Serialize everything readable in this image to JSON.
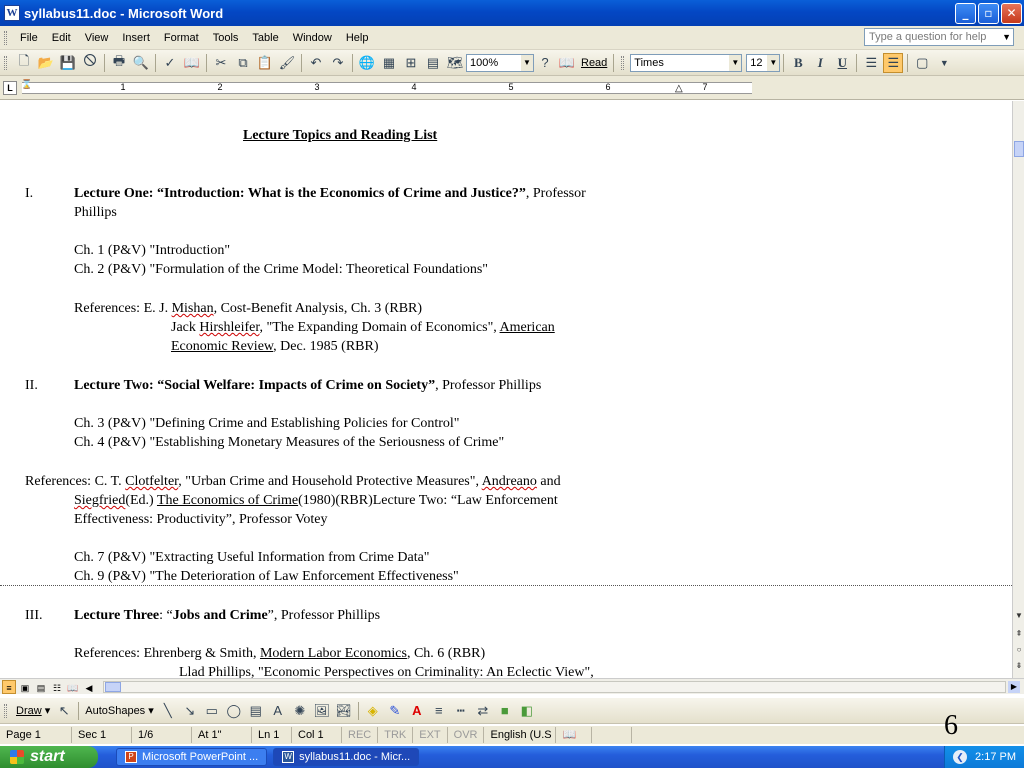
{
  "window": {
    "title": "syllabus11.doc - Microsoft Word",
    "min": "_",
    "max": "▫",
    "close": "✕"
  },
  "menu": {
    "items": [
      "File",
      "Edit",
      "View",
      "Insert",
      "Format",
      "Tools",
      "Table",
      "Window",
      "Help"
    ],
    "help_placeholder": "Type a question for help"
  },
  "toolbar": {
    "zoom": "100%",
    "read_label": "Read",
    "font": "Times",
    "font_size": "12",
    "bold": "B",
    "italic": "I",
    "underline": "U"
  },
  "ruler": {
    "numbers": [
      "1",
      "2",
      "3",
      "4",
      "5",
      "6",
      "7"
    ],
    "tab_selector": "L"
  },
  "document": {
    "heading": "Lecture Topics and Reading List",
    "l1_num": "I.",
    "l1_a": "Lecture One: “Introduction: What is the Economics of Crime and Justice?”",
    "l1_b": ", Professor",
    "l1_c": "Phillips",
    "ch1": "Ch. 1 (P&V)  \"Introduction\"",
    "ch2": "Ch. 2 (P&V)  \"Formulation of the Crime Model:  Theoretical Foundations\"",
    "ref1_label": "References:  E. J. ",
    "ref1_name": "Mishan",
    "ref1_rest": ", Cost-Benefit Analysis, Ch. 3 (RBR)",
    "ref1b_a": "Jack ",
    "ref1b_name": "Hirshleifer",
    "ref1b_b": ", \"The Expanding Domain of Economics\", ",
    "ref1b_journal": "American",
    "ref1c_journal": "Economic Review",
    "ref1c_rest": ", Dec. 1985 (RBR)",
    "l2_num": "II.",
    "l2_a": "Lecture Two: “Social Welfare: Impacts of Crime on Society”",
    "l2_b": ", Professor Phillips",
    "ch3": "Ch. 3 (P&V)  \"Defining Crime and Establishing Policies for Control\"",
    "ch4": "Ch. 4 (P&V)  \"Establishing Monetary Measures of the Seriousness of Crime\"",
    "ref2_a": "References: C. T. ",
    "ref2_name": "Clotfelter",
    "ref2_b": ", \"Urban Crime and Household Protective Measures\", ",
    "ref2_name2": "Andreano",
    "ref2_c": " and",
    "ref2b_name": "Siegfried",
    "ref2b_a": "(Ed.) ",
    "ref2b_book": "The Economics of Crime",
    "ref2b_b": "(1980)(RBR)Lecture Two: “Law  Enforcement",
    "ref2c": "Effectiveness:  Productivity”, Professor Votey",
    "ch7": "Ch. 7 (P&V)  \"Extracting Useful Information from Crime Data\"",
    "ch9": "Ch. 9 (P&V)  \"The Deterioration of Law Enforcement Effectiveness\"",
    "l3_num": "III.",
    "l3_a": "Lecture Three",
    "l3_b": ": “",
    "l3_c": "Jobs and Crime",
    "l3_d": "”, Professor Phillips",
    "ref3_a": "References: Ehrenberg & Smith, ",
    "ref3_book": "Modern Labor Economics",
    "ref3_b": ", Ch. 6 (RBR)",
    "ref3b": "Llad Phillips, \"Economic Perspectives on Criminality: An Eclectic View\","
  },
  "drawbar": {
    "draw_label": "Draw",
    "autoshapes_label": "AutoShapes"
  },
  "status": {
    "page": "Page 1",
    "sec": "Sec 1",
    "pages": "1/6",
    "at": "At 1\"",
    "ln": "Ln 1",
    "col": "Col 1",
    "rec": "REC",
    "trk": "TRK",
    "ext": "EXT",
    "ovr": "OVR",
    "lang": "English (U.S"
  },
  "overlay": {
    "slide_number": "6"
  },
  "taskbar": {
    "start": "start",
    "tasks": [
      "Microsoft PowerPoint ...",
      "syllabus11.doc - Micr..."
    ],
    "clock": "2:17 PM"
  }
}
